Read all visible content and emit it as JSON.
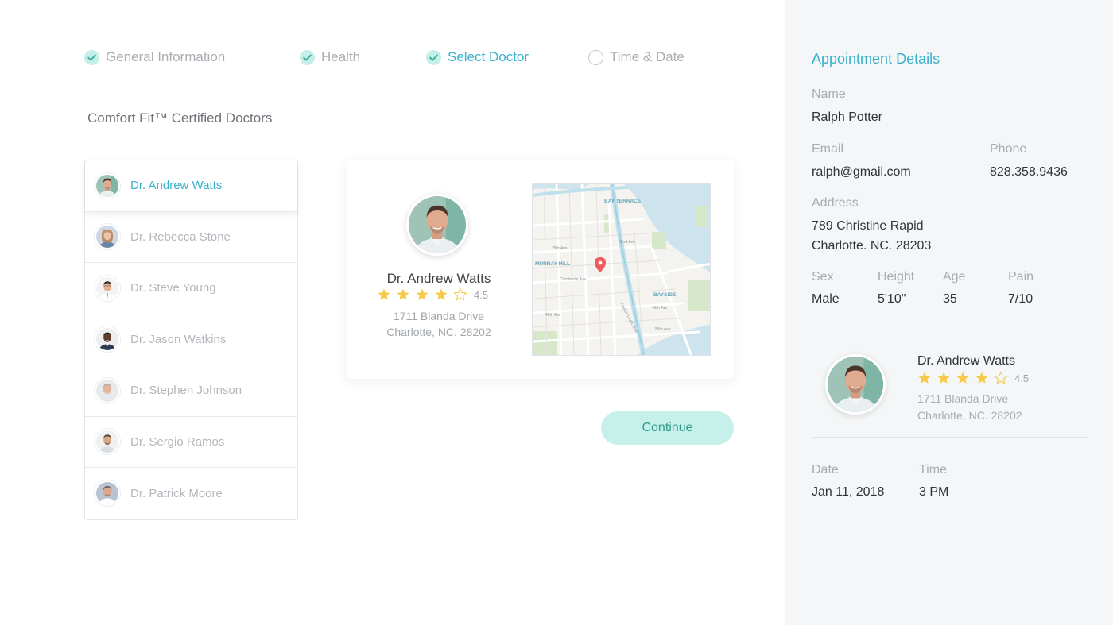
{
  "steps": [
    {
      "label": "General Information",
      "state": "done"
    },
    {
      "label": "Health",
      "state": "done"
    },
    {
      "label": "Select Doctor",
      "state": "active"
    },
    {
      "label": "Time & Date",
      "state": "todo"
    }
  ],
  "section_title": "Comfort Fit™ Certified Doctors",
  "doctors": [
    {
      "name": "Dr. Andrew Watts",
      "selected": true
    },
    {
      "name": "Dr. Rebecca Stone",
      "selected": false
    },
    {
      "name": "Dr. Steve Young",
      "selected": false
    },
    {
      "name": "Dr. Jason Watkins",
      "selected": false
    },
    {
      "name": "Dr. Stephen Johnson",
      "selected": false
    },
    {
      "name": "Dr. Sergio Ramos",
      "selected": false
    },
    {
      "name": "Dr. Patrick Moore",
      "selected": false
    }
  ],
  "selected_doctor": {
    "name": "Dr. Andrew Watts",
    "rating": "4.5",
    "rating_value": 4.5,
    "address_line1": "1711 Blanda Drive",
    "address_line2": "Charlotte, NC. 28202"
  },
  "map": {
    "labels": [
      "BAY TERRACE",
      "MURRAY HILL",
      "BAYSIDE",
      "29th Ave",
      "32nd Ave",
      "Crocheron Ave",
      "46th Ave",
      "48th Ave",
      "56th Ave",
      "Francis Lewis Blvd"
    ]
  },
  "continue_label": "Continue",
  "panel": {
    "title": "Appointment Details",
    "name_label": "Name",
    "name_value": "Ralph Potter",
    "email_label": "Email",
    "email_value": "ralph@gmail.com",
    "phone_label": "Phone",
    "phone_value": "828.358.9436",
    "address_label": "Address",
    "address_line1": "789 Christine Rapid",
    "address_line2": "Charlotte. NC. 28203",
    "sex_label": "Sex",
    "sex_value": "Male",
    "height_label": "Height",
    "height_value": "5'10\"",
    "age_label": "Age",
    "age_value": "35",
    "pain_label": "Pain",
    "pain_value": "7/10",
    "doctor_name": "Dr. Andrew Watts",
    "doctor_rating": "4.5",
    "doctor_address_line1": "1711 Blanda Drive",
    "doctor_address_line2": "Charlotte, NC. 28202",
    "date_label": "Date",
    "date_value": "Jan 11, 2018",
    "time_label": "Time",
    "time_value": "3 PM"
  },
  "colors": {
    "accent": "#3ab1cc",
    "check_bg": "#c5efe8",
    "check_mark": "#3db5a3",
    "star": "#f7c948",
    "button_bg": "#c5f1ea",
    "button_text": "#2f9a8a",
    "panel_bg": "#f5f6f7",
    "map_pin": "#ef5a5a"
  }
}
